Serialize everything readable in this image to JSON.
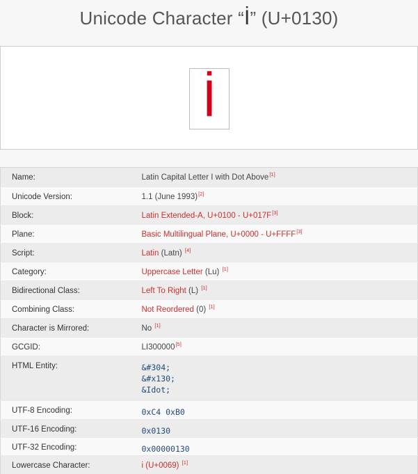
{
  "title": {
    "prefix": "Unicode Character “",
    "glyph": "İ",
    "suffix": "” (U+0130)"
  },
  "preview": {
    "glyph": "İ"
  },
  "rows": [
    {
      "label": "Name:",
      "value": "Latin Capital Letter I with Dot Above",
      "ref": "[1]"
    },
    {
      "label": "Unicode Version:",
      "value": "1.1 (June 1993)",
      "ref": "[2]"
    },
    {
      "label": "Block:",
      "value": "Latin Extended-A, U+0100 - U+017F",
      "ref": "[3]"
    },
    {
      "label": "Plane:",
      "value": "Basic Multilingual Plane, U+0000 - U+FFFF",
      "ref": "[3]"
    },
    {
      "label": "Script:",
      "link": "Latin",
      "rest": " (Latn) ",
      "ref": "[4]"
    },
    {
      "label": "Category:",
      "link": "Uppercase Letter",
      "rest": " (Lu) ",
      "ref": "[1]"
    },
    {
      "label": "Bidirectional Class:",
      "link": "Left To Right",
      "rest": " (L) ",
      "ref": "[1]"
    },
    {
      "label": "Combining Class:",
      "link": "Not Reordered",
      "rest": " (0) ",
      "ref": "[1]"
    },
    {
      "label": "Character is Mirrored:",
      "value": "No ",
      "ref": "[1]"
    },
    {
      "label": "GCGID:",
      "value": "LI300000",
      "ref": "[5]"
    },
    {
      "label": "HTML Entity:",
      "entities": [
        "&#304;",
        "&#x130;",
        "&Idot;"
      ]
    },
    {
      "label": "UTF-8 Encoding:",
      "code": "0xC4 0xB0"
    },
    {
      "label": "UTF-16 Encoding:",
      "code": "0x0130"
    },
    {
      "label": "UTF-32 Encoding:",
      "code": "0x00000130"
    },
    {
      "label": "Lowercase Character:",
      "value": "i (U+0069) ",
      "ref": "[1]"
    }
  ],
  "colors": {
    "accent": "#d0021b",
    "link": "#c9302c",
    "code": "#234a7a"
  }
}
